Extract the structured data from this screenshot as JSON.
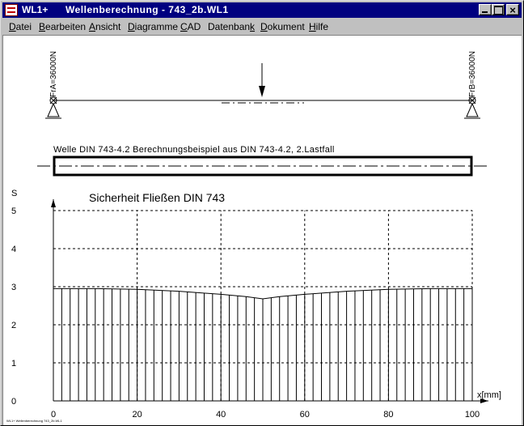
{
  "window": {
    "app_name": "WL1+",
    "document_title": "Wellenberechnung  -  743_2b.WL1"
  },
  "menu": [
    {
      "pre": "",
      "u": "D",
      "post": "atei"
    },
    {
      "pre": "",
      "u": "B",
      "post": "earbeiten"
    },
    {
      "pre": "",
      "u": "A",
      "post": "nsicht"
    },
    {
      "pre": "",
      "u": "D",
      "post": "iagramme"
    },
    {
      "pre": "",
      "u": "C",
      "post": "AD"
    },
    {
      "pre": "Datenban",
      "u": "k",
      "post": ""
    },
    {
      "pre": "",
      "u": "D",
      "post": "okument"
    },
    {
      "pre": "",
      "u": "H",
      "post": "ilfe"
    }
  ],
  "beam": {
    "left_support_label": "FrA=36000N",
    "right_support_label": "FrB=36000N"
  },
  "shaft": {
    "caption": "Welle DIN 743-4.2  Berechnungsbeispiel aus DIN 743-4.2, 2.Lastfall"
  },
  "footer_text": "WL1+ Wellenberechnung 743_2b.WL1",
  "chart_data": {
    "type": "bar",
    "title": "Sicherheit Fließen DIN 743",
    "xlabel": "x[mm]",
    "ylabel": "S",
    "xlim": [
      0,
      100
    ],
    "ylim": [
      0,
      5
    ],
    "x_ticks": [
      0,
      20,
      40,
      60,
      80,
      100
    ],
    "y_ticks": [
      0,
      1,
      2,
      3,
      4,
      5
    ],
    "grid": true,
    "bar_step": 2,
    "profile": {
      "x": [
        0,
        10,
        20,
        30,
        40,
        46,
        50,
        54,
        60,
        70,
        80,
        90,
        100
      ],
      "y": [
        2.95,
        2.95,
        2.93,
        2.88,
        2.8,
        2.74,
        2.68,
        2.74,
        2.8,
        2.88,
        2.93,
        2.95,
        2.95
      ]
    }
  }
}
